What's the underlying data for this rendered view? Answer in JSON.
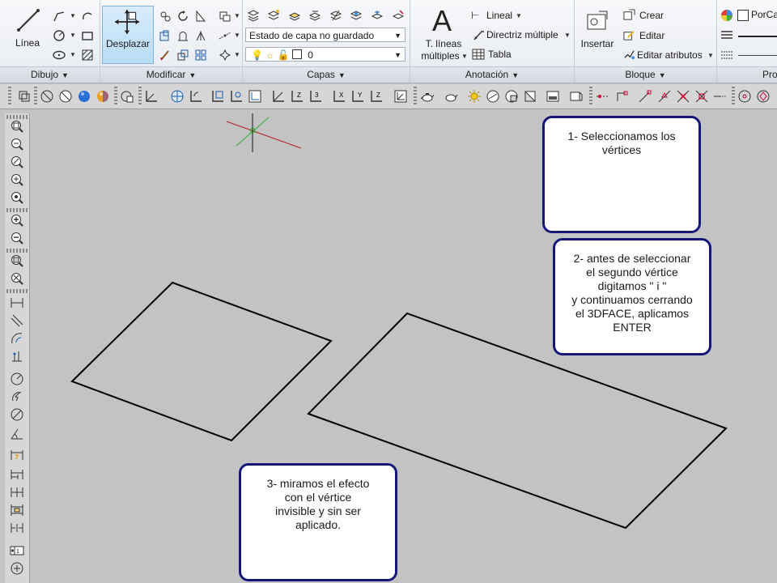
{
  "ribbon": {
    "dibujo": {
      "title": "Dibujo",
      "line_label": "Línea"
    },
    "modificar": {
      "title": "Modificar",
      "move_label": "Desplazar"
    },
    "capas": {
      "title": "Capas",
      "layer_state": "Estado de capa no guardado",
      "current_layer": "0"
    },
    "anotacion": {
      "title": "Anotación",
      "mtext_label_line1": "T. líneas",
      "mtext_label_line2": "múltiples",
      "linear_label": "Lineal",
      "mleader_label": "Directriz múltiple",
      "table_label": "Tabla"
    },
    "bloque": {
      "title": "Bloque",
      "insert_label": "Insertar",
      "create_label": "Crear",
      "edit_label": "Editar",
      "edit_attr_label": "Editar atributos"
    },
    "propiedades": {
      "title": "Pro",
      "color_value": "PorCa"
    }
  },
  "notes": [
    {
      "text": "1- Seleccionamos los\nvértices"
    },
    {
      "text": "2- antes de seleccionar\nel segundo vértice\ndigitamos \" i \"\ny continuamos cerrando\nel 3DFACE, aplicamos\nENTER"
    },
    {
      "text": "3- miramos el efecto\ncon el vértice\ninvisible y sin ser\naplicado."
    }
  ],
  "colors": {
    "canvas": "#c3c3c3",
    "note_border": "#16167a",
    "ucs_x": "#b0222a",
    "ucs_y": "#2fae3a",
    "ucs_z": "#111111",
    "faces": "#000000"
  }
}
